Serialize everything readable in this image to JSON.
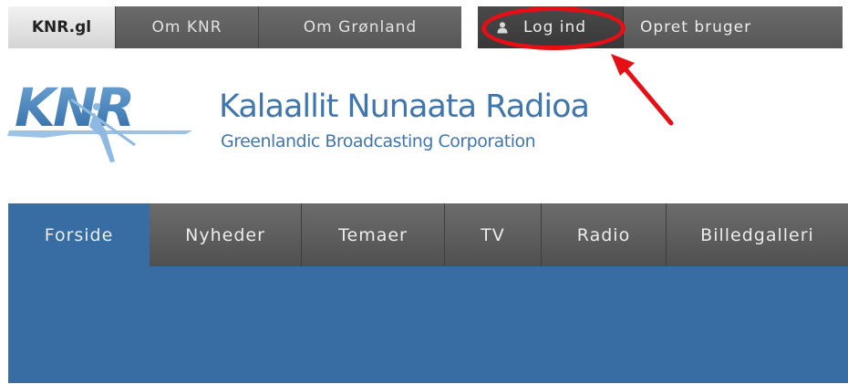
{
  "topbar": {
    "items": [
      {
        "label": "KNR.gl"
      },
      {
        "label": "Om KNR"
      },
      {
        "label": "Om Grønland"
      }
    ],
    "login_label": "Log ind",
    "register_label": "Opret bruger",
    "login_icon": "person-icon"
  },
  "header": {
    "logo_text": "KNR",
    "org_name": "Kalaallit Nunaata Radioa",
    "org_subtitle": "Greenlandic Broadcasting Corporation"
  },
  "mainnav": {
    "items": [
      {
        "label": "Forside",
        "active": true
      },
      {
        "label": "Nyheder"
      },
      {
        "label": "Temaer"
      },
      {
        "label": "TV"
      },
      {
        "label": "Radio"
      },
      {
        "label": "Billedgalleri"
      }
    ]
  },
  "colors": {
    "brand_blue": "#376da3",
    "logo_blue": "#3f76ae",
    "nav_gray": "#5e5e5e",
    "annotation_red": "#e60f16"
  }
}
